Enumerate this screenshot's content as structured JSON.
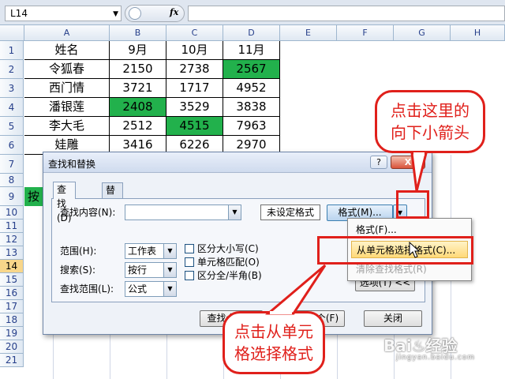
{
  "formula_bar": {
    "name_box": "L14",
    "fx": "fx"
  },
  "columns": [
    "A",
    "B",
    "C",
    "D",
    "E",
    "F",
    "G",
    "H"
  ],
  "rows": [
    "1",
    "2",
    "3",
    "4",
    "5",
    "6",
    "7",
    "8",
    "9",
    "10",
    "11",
    "12",
    "13",
    "14",
    "15",
    "16",
    "17",
    "18",
    "19",
    "20",
    "21"
  ],
  "table": {
    "header": [
      "姓名",
      "9月",
      "10月",
      "11月"
    ],
    "rows": [
      [
        "令狐春",
        "2150",
        "2738",
        "2567"
      ],
      [
        "西门情",
        "3721",
        "1717",
        "4952"
      ],
      [
        "潘银莲",
        "2408",
        "3529",
        "3838"
      ],
      [
        "李大毛",
        "2512",
        "4515",
        "7963"
      ],
      [
        "娃雕",
        "3416",
        "6226",
        "2970"
      ]
    ],
    "row9_text": "按"
  },
  "dialog": {
    "title": "查找和替换",
    "help": "?",
    "close": "X",
    "tabs": [
      "查找(D)",
      "替换(P)"
    ],
    "find_label": "查找内容(N):",
    "find_value": "",
    "no_format": "未设定格式",
    "format_btn": "格式(M)...",
    "scope_label": "范围(H):",
    "scope_value": "工作表",
    "search_label": "搜索(S):",
    "search_value": "按行",
    "lookin_label": "查找范围(L):",
    "lookin_value": "公式",
    "match_case": "区分大小写(C)",
    "match_cell": "单元格匹配(O)",
    "match_width": "区分全/半角(B)",
    "options_btn": "选项(T) <<",
    "find_all": "查找全部(I)",
    "find_next": "查找下一个(F)",
    "close_btn": "关闭"
  },
  "menu": {
    "items": [
      "格式(F)...",
      "从单元格选择格式(C)...",
      "清除查找格式(R)"
    ]
  },
  "annotations": {
    "top": [
      "点击这里的",
      "向下小箭头"
    ],
    "bottom": [
      "点击从单元",
      "格选择格式"
    ]
  },
  "colors": {
    "accent_red": "#e0201b",
    "cell_green": "#22b14c",
    "active_row": "#f8d68a"
  }
}
